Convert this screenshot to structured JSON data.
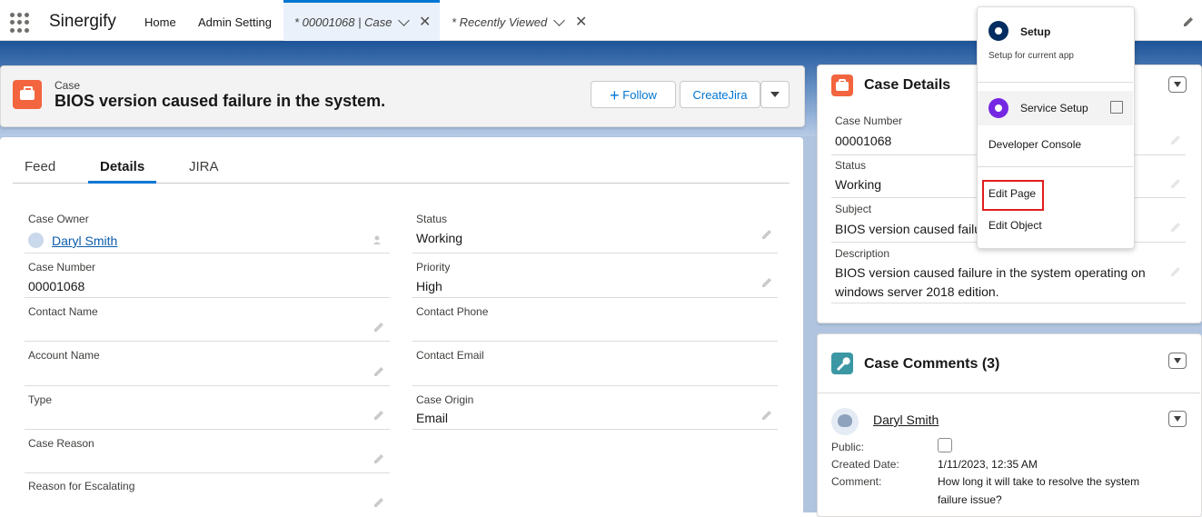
{
  "nav": {
    "app_name": "Sinergify",
    "tabs": [
      {
        "label": "Home"
      },
      {
        "label": "Admin Setting"
      },
      {
        "label": "* 00001068 | Case"
      },
      {
        "label": "* Recently Viewed"
      }
    ]
  },
  "record": {
    "object_label": "Case",
    "title": "BIOS version caused failure in the system.",
    "buttons": {
      "follow": "Follow",
      "create_jira": "CreateJira"
    }
  },
  "detail_tabs": [
    "Feed",
    "Details",
    "JIRA"
  ],
  "fields": {
    "case_owner": {
      "label": "Case Owner",
      "value": "Daryl Smith"
    },
    "status": {
      "label": "Status",
      "value": "Working"
    },
    "case_number": {
      "label": "Case Number",
      "value": "00001068"
    },
    "priority": {
      "label": "Priority",
      "value": "High"
    },
    "contact_name": {
      "label": "Contact Name",
      "value": ""
    },
    "contact_phone": {
      "label": "Contact Phone",
      "value": ""
    },
    "account_name": {
      "label": "Account Name",
      "value": ""
    },
    "contact_email": {
      "label": "Contact Email",
      "value": ""
    },
    "type": {
      "label": "Type",
      "value": ""
    },
    "case_origin": {
      "label": "Case Origin",
      "value": "Email"
    },
    "case_reason": {
      "label": "Case Reason",
      "value": ""
    },
    "reason_escalating": {
      "label": "Reason for Escalating",
      "value": ""
    }
  },
  "case_details_card": {
    "title": "Case Details",
    "case_number": {
      "label": "Case Number",
      "value": "00001068"
    },
    "status": {
      "label": "Status",
      "value": "Working"
    },
    "subject": {
      "label": "Subject",
      "value": "BIOS version caused failu"
    },
    "description": {
      "label": "Description",
      "line1": "BIOS version caused failure in the system operating on",
      "line2": "windows server 2018 edition."
    }
  },
  "comments_card": {
    "title": "Case Comments (3)",
    "author": "Daryl Smith",
    "public_label": "Public:",
    "created_label": "Created Date:",
    "created_value": "1/11/2023, 12:35 AM",
    "comment_label": "Comment:",
    "comment_line1": "How long it will take to resolve the system",
    "comment_line2": "failure issue?"
  },
  "setup_menu": {
    "setup_title": "Setup",
    "setup_sub": "Setup for current app",
    "service_setup": "Service Setup",
    "developer_console": "Developer Console",
    "edit_page": "Edit Page",
    "edit_object": "Edit Object"
  },
  "colors": {
    "brand": "#0176d3",
    "case_icon": "#f2653e",
    "setup_icon": "#032d60",
    "service_icon": "#7526e3",
    "highlight": "#e01e1e"
  }
}
